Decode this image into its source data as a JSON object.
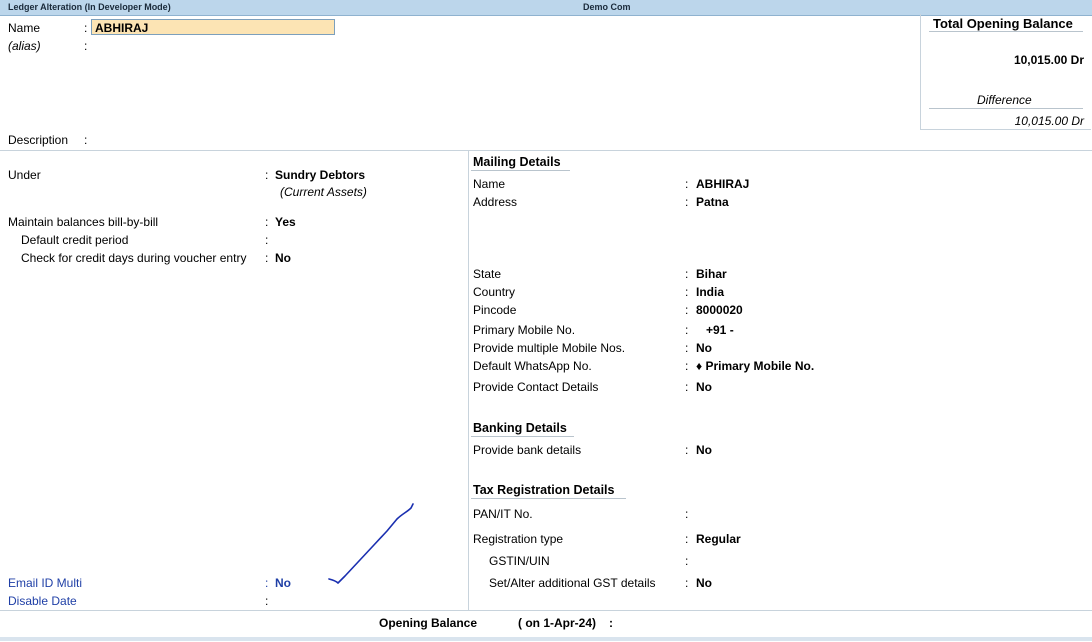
{
  "window": {
    "title": "Ledger Alteration (In Developer Mode)",
    "company": "Demo Com"
  },
  "header": {
    "name_label": "Name",
    "name_value": "ABHIRAJ",
    "alias_label": "(alias)",
    "description_label": "Description"
  },
  "balance_panel": {
    "title": "Total Opening Balance",
    "amount": "10,015.00 Dr",
    "difference_label": "Difference",
    "difference_amount": "10,015.00 Dr"
  },
  "left": {
    "under_label": "Under",
    "under_value": "Sundry Debtors",
    "under_group": "(Current Assets)",
    "bill_by_bill_label": "Maintain balances bill-by-bill",
    "bill_by_bill_value": "Yes",
    "credit_period_label": "Default credit period",
    "credit_days_label": "Check for credit days during voucher entry",
    "credit_days_value": "No",
    "email_multi_label": "Email ID Multi",
    "email_multi_value": "No",
    "disable_date_label": "Disable Date"
  },
  "mailing": {
    "title": "Mailing Details",
    "name_label": "Name",
    "name_value": "ABHIRAJ",
    "address_label": "Address",
    "address_value": "Patna",
    "state_label": "State",
    "state_value": "Bihar",
    "country_label": "Country",
    "country_value": "India",
    "pincode_label": "Pincode",
    "pincode_value": "8000020",
    "mobile_label": "Primary Mobile No.",
    "mobile_value": "+91  -",
    "multi_mobile_label": "Provide multiple Mobile Nos.",
    "multi_mobile_value": "No",
    "whatsapp_label": "Default WhatsApp No.",
    "whatsapp_value": "♦ Primary Mobile No.",
    "contact_label": "Provide Contact Details",
    "contact_value": "No"
  },
  "banking": {
    "title": "Banking Details",
    "bank_label": "Provide bank details",
    "bank_value": "No"
  },
  "tax": {
    "title": "Tax Registration Details",
    "pan_label": "PAN/IT No.",
    "reg_type_label": "Registration type",
    "reg_type_value": "Regular",
    "gstin_label": "GSTIN/UIN",
    "gst_details_label": "Set/Alter additional GST details",
    "gst_details_value": "No"
  },
  "footer": {
    "opening_label": "Opening Balance",
    "opening_date": "( on 1-Apr-24)",
    "opening_colon": ":"
  },
  "colors": {
    "titlebar": "#bcd6eb",
    "name_field": "#fce4b4",
    "blue_label": "#1f3fa6",
    "annotation": "#1a2fb0"
  }
}
